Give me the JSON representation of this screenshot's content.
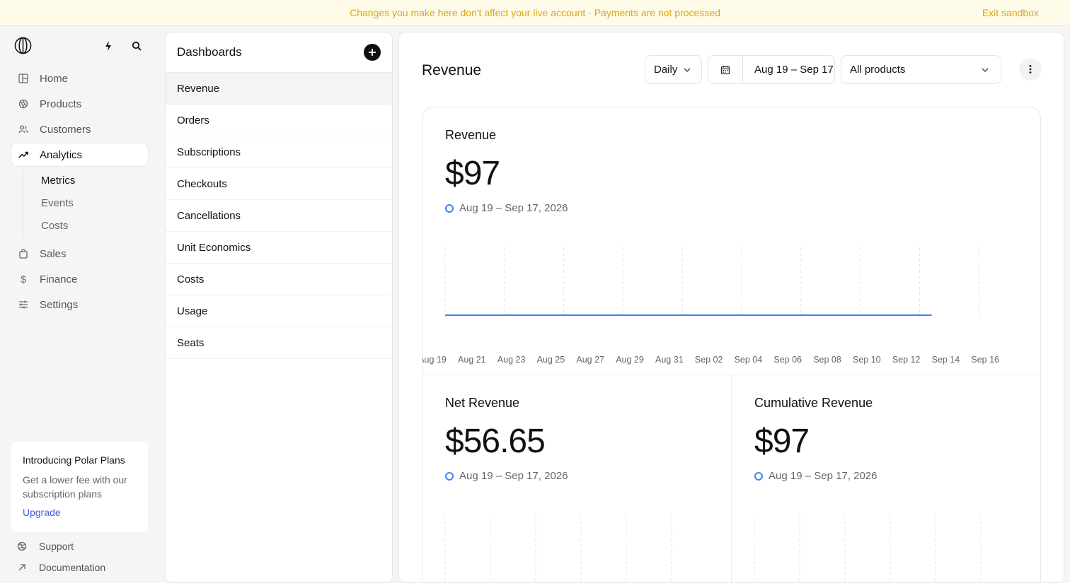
{
  "banner": {
    "message": "Changes you make here don't affect your live account · Payments are not processed",
    "exit_label": "Exit sandbox"
  },
  "sidebar": {
    "items": [
      {
        "label": "Home",
        "icon": "home-icon"
      },
      {
        "label": "Products",
        "icon": "products-icon"
      },
      {
        "label": "Customers",
        "icon": "customers-icon"
      },
      {
        "label": "Analytics",
        "icon": "analytics-icon"
      }
    ],
    "subitems": [
      {
        "label": "Metrics"
      },
      {
        "label": "Events"
      },
      {
        "label": "Costs"
      }
    ],
    "items_after": [
      {
        "label": "Sales",
        "icon": "sales-icon"
      },
      {
        "label": "Finance",
        "icon": "finance-icon"
      },
      {
        "label": "Settings",
        "icon": "settings-icon"
      }
    ],
    "promo": {
      "title": "Introducing Polar Plans",
      "text": "Get a lower fee with our subscription plans",
      "link": "Upgrade"
    },
    "footer": [
      {
        "label": "Support",
        "icon": "support-icon"
      },
      {
        "label": "Documentation",
        "icon": "external-link-icon"
      }
    ]
  },
  "dashboards": {
    "title": "Dashboards",
    "items": [
      "Revenue",
      "Orders",
      "Subscriptions",
      "Checkouts",
      "Cancellations",
      "Unit Economics",
      "Costs",
      "Usage",
      "Seats"
    ]
  },
  "main": {
    "title": "Revenue",
    "interval": "Daily",
    "date_range": "Aug 19 – Sep 17",
    "product_filter": "All products"
  },
  "metrics": {
    "revenue": {
      "label": "Revenue",
      "value": "$97",
      "range": "Aug 19 – Sep 17, 2026"
    },
    "net_revenue": {
      "label": "Net Revenue",
      "value": "$56.65",
      "range": "Aug 19 – Sep 17, 2026"
    },
    "cumulative_revenue": {
      "label": "Cumulative Revenue",
      "value": "$97",
      "range": "Aug 19 – Sep 17, 2026"
    }
  },
  "chart_data": {
    "type": "line",
    "x": [
      "Aug 19",
      "Aug 21",
      "Aug 23",
      "Aug 25",
      "Aug 27",
      "Aug 29",
      "Aug 31",
      "Sep 02",
      "Sep 04",
      "Sep 06",
      "Sep 08",
      "Sep 10",
      "Sep 12",
      "Sep 14",
      "Sep 16"
    ],
    "series": [
      {
        "values": [
          0,
          0,
          0,
          0,
          0,
          0,
          0,
          0,
          0,
          0,
          0,
          0,
          0
        ]
      }
    ],
    "line_color": "#3b82f6",
    "grid": "vertical dashed"
  },
  "colors": {
    "accent": "#3b82f6",
    "banner_text": "#dca51a",
    "link": "#4c5bdb"
  }
}
